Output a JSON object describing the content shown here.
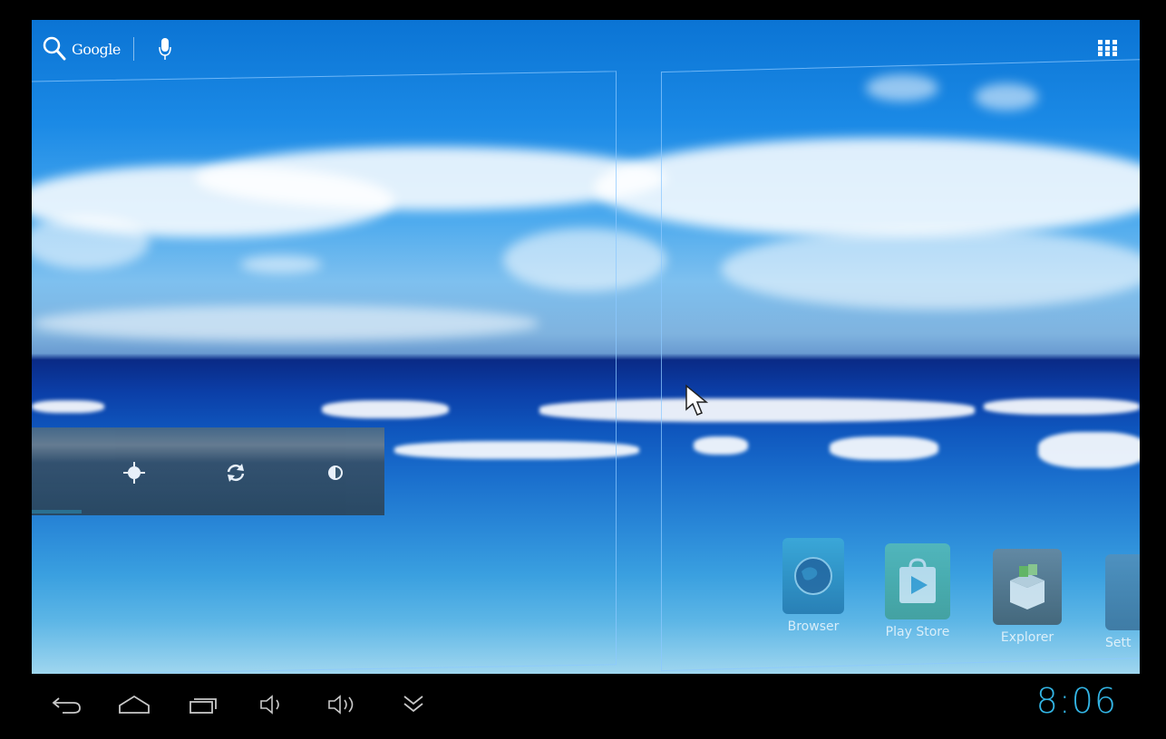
{
  "top_bar": {
    "search_label": "Google",
    "search_icon": "search-icon",
    "mic_icon": "mic-icon",
    "apps_icon": "all-apps-icon"
  },
  "power_widget": {
    "buttons": [
      {
        "icon": "gps-icon"
      },
      {
        "icon": "sync-icon"
      },
      {
        "icon": "brightness-icon"
      }
    ]
  },
  "apps": [
    {
      "label": "Browser",
      "icon": "browser-globe-icon"
    },
    {
      "label": "Play Store",
      "icon": "play-store-icon"
    },
    {
      "label": "Explorer",
      "icon": "explorer-box-icon"
    },
    {
      "label": "Sett",
      "icon": "settings-icon"
    }
  ],
  "nav_bar": {
    "buttons": [
      "back-icon",
      "home-icon",
      "recent-apps-icon",
      "volume-down-icon",
      "volume-up-icon",
      "notifications-down-icon"
    ],
    "clock": "8:06"
  },
  "colors": {
    "clock": "#33b5e5",
    "accent": "#33b5e5"
  }
}
